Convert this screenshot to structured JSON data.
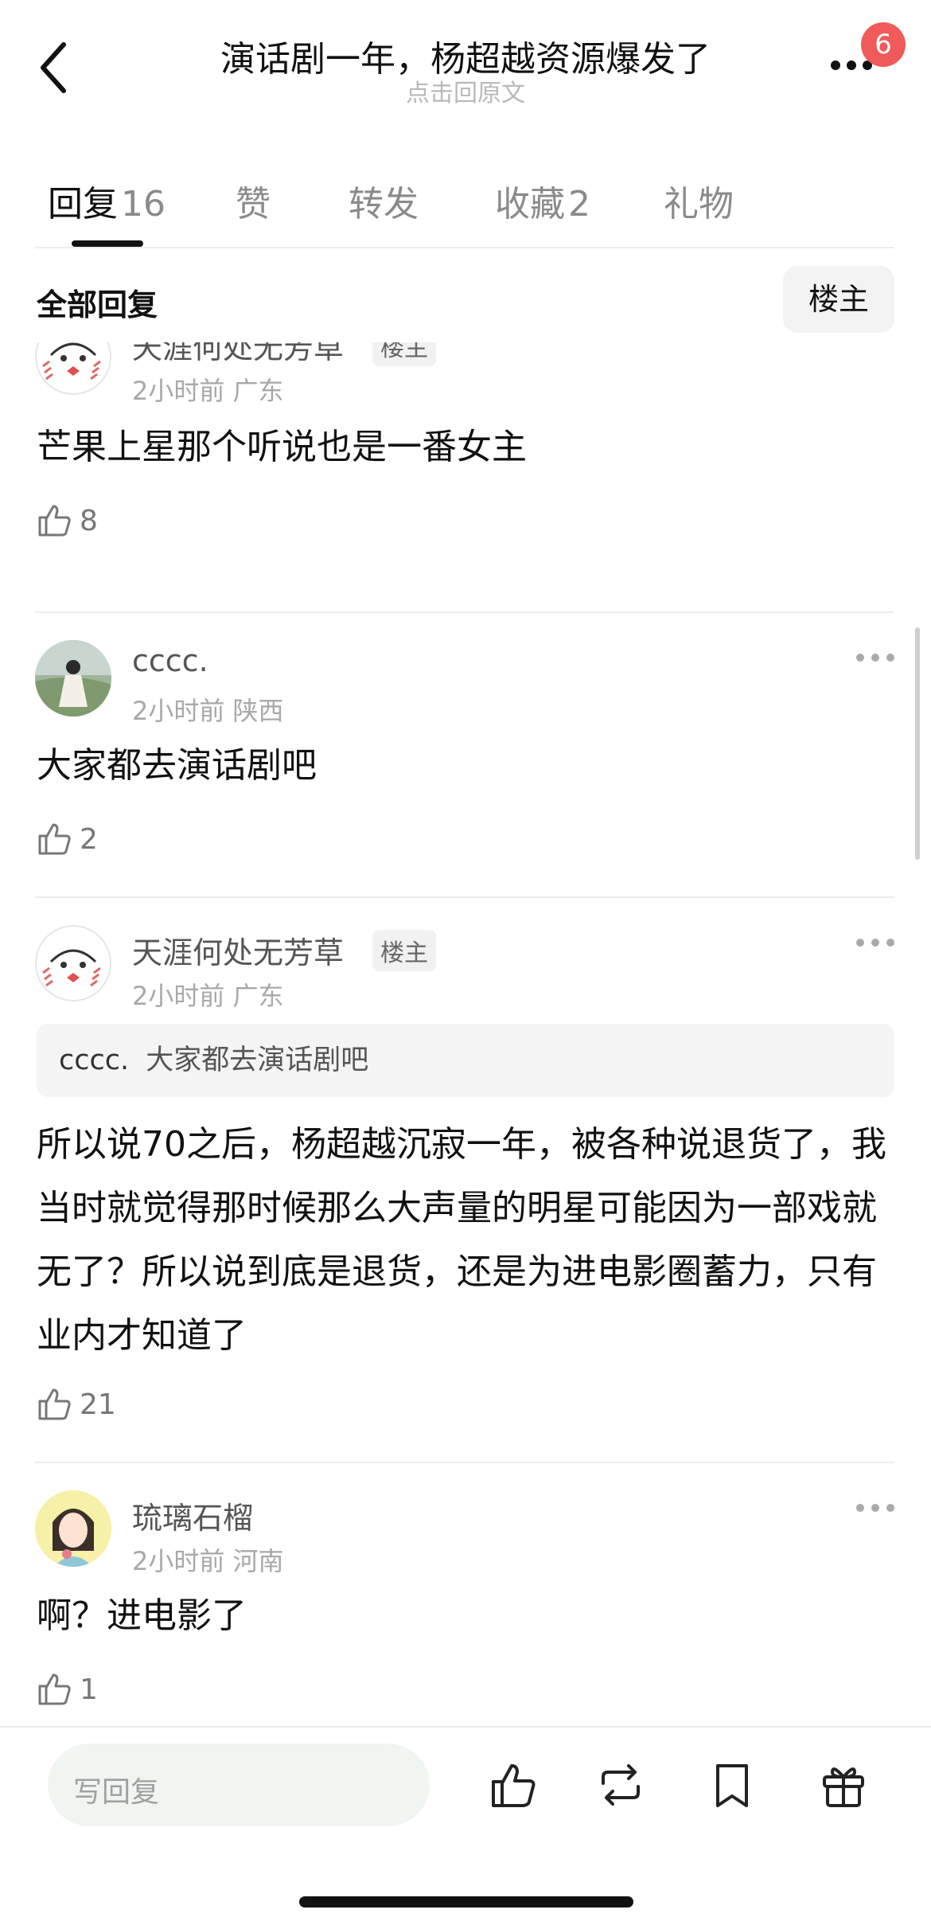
{
  "header": {
    "title": "演话剧一年，杨超越资源爆发了",
    "subtitle": "点击回原文",
    "badge_count": "6"
  },
  "tabs": [
    {
      "label": "回复",
      "count": "16"
    },
    {
      "label": "赞",
      "count": ""
    },
    {
      "label": "转发",
      "count": ""
    },
    {
      "label": "收藏",
      "count": "2"
    },
    {
      "label": "礼物",
      "count": ""
    }
  ],
  "filter": {
    "title": "全部回复",
    "owner_button": "楼主"
  },
  "comments": [
    {
      "user": "天涯何处无芳草",
      "tag": "楼主",
      "time": "2小时前",
      "location": "广东",
      "text": "芒果上星那个听说也是一番女主",
      "likes": "8"
    },
    {
      "user": "cccc.",
      "tag": "",
      "time": "2小时前",
      "location": "陕西",
      "text": "大家都去演话剧吧",
      "likes": "2"
    },
    {
      "user": "天涯何处无芳草",
      "tag": "楼主",
      "time": "2小时前",
      "location": "广东",
      "quote_user": "cccc.",
      "quote_text": "大家都去演话剧吧",
      "text": "所以说70之后，杨超越沉寂一年，被各种说退货了，我当时就觉得那时候那么大声量的明星可能因为一部戏就无了？所以说到底是退货，还是为进电影圈蓄力，只有业内才知道了",
      "likes": "21"
    },
    {
      "user": "琉璃石榴",
      "tag": "",
      "time": "2小时前",
      "location": "河南",
      "text": "啊？进电影了",
      "likes": "1"
    }
  ],
  "bottom": {
    "reply_placeholder": "写回复"
  },
  "icons": [
    "back-icon",
    "more-icon",
    "like-icon",
    "repost-icon",
    "bookmark-icon",
    "gift-icon"
  ],
  "colors": {
    "badge": "#f05a5a",
    "accent": "#111111",
    "muted": "#a8a8a8"
  }
}
